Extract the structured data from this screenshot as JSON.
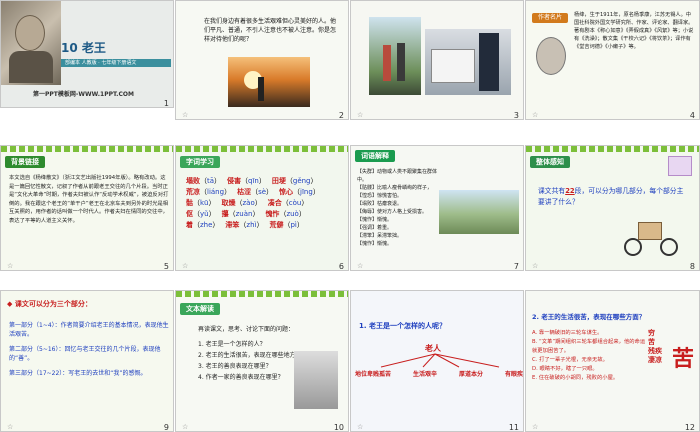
{
  "slides": [
    {
      "n": "1",
      "title": "10 老王",
      "sub": "部编本 人教版 · 七年级下册语文",
      "footer": "第一PPT模板网-WWW.1PPT.COM"
    },
    {
      "n": "2",
      "text": "在我们身边有着很多生活艰难但心灵美好的人。他们平凡、普通，不引人注意也不被人注意。你是怎样对待他们的呢？"
    },
    {
      "n": "3"
    },
    {
      "n": "4",
      "tag": "作者名片",
      "text": "杨绛，生于1911年，原名杨季康，江苏无锡人。中国社科院外国文学研究所、作家、评论家、翻译家。著有剧本《称心如意》《弄假成真》《风絮》等；小说有《洗澡》；散文集《干校六记》《将饮茶》；译作有《堂吉诃德》《小癞子》等。"
    },
    {
      "n": "5",
      "tag": "背景链接",
      "text": "本文选自《杨绛散文》（浙江文艺出版社1994年版）。略有改动。这是一篇回忆性散文，记叙了作者从前跟老王交往的几个片段。当时正是“文化大革命”时期，作者夫妇被认作“反动学术权威”，被迫反对打倒的。我在跟这个老王的“单干户”老王在北京车夫到另外的时光是相互关照的，用作者的话叫做一个时代人。作者夫妇在情同的交往中，表达了平等的人道主义关怀。"
    },
    {
      "n": "6",
      "tag": "字词学习",
      "words": [
        [
          "塌败",
          "tā",
          "侵害",
          "qīn",
          "田埂",
          "gěng"
        ],
        [
          "荒凉",
          "liáng",
          "枯涩",
          "sè",
          "惊心",
          "jīng"
        ],
        [
          "骷",
          "kū",
          "取燥",
          "zào",
          "凑合",
          "còu"
        ],
        [
          "伛",
          "yǔ",
          "攥",
          "zuàn",
          "愧怍",
          "zuò"
        ],
        [
          "着",
          "zhe",
          "滞笨",
          "zhì",
          "荒僻",
          "pì"
        ]
      ]
    },
    {
      "n": "7",
      "tag": "词语解释",
      "items": [
        "【失群】动物或人类不跟聚集在群体中。",
        "【骷髅】比喻人瘦骨嶙峋的样子，",
        "【惶恐】惊慌害怕。",
        "【塌败】枯瘪衰退。",
        "【侮辱】使对方人格上受损害。",
        "【愧怍】惭愧。",
        "【强调】着重。",
        "【滞笨】呆滞笨拙。",
        "【愧怍】惭愧。"
      ]
    },
    {
      "n": "8",
      "tag": "整体感知",
      "text": "课文共有",
      "mid": "22",
      "text2": "段，可以分为哪几部分，每个部分主要讲了什么？"
    },
    {
      "n": "9",
      "head": "课文可以分为三个部分：",
      "items": [
        "第一部分（1~4）：作者简要介绍老王的基本情况，表现他生活艰苦。",
        "第二部分（5~16）：回忆与老王交往的几个片段，表现他的“善”。",
        "第三部分（17~22）：写老王的去世和“我”的感慨。"
      ]
    },
    {
      "n": "10",
      "tag": "文本解读",
      "lead": "再读课文，思考、讨论下面的问题：",
      "items": [
        "1. 老王是一个怎样的人？",
        "2. 老王的生活很苦，表现在哪些地方？",
        "3. 老王的善良表现在哪里？",
        "4. 作者一家的善良表现在哪里？"
      ]
    },
    {
      "n": "11",
      "q": "1. 老王是一个怎样的人呢？",
      "root": "老人",
      "leaves": [
        "地位卑贱孤苦",
        "生活艰辛",
        "厚道本分",
        "有眼疾"
      ]
    },
    {
      "n": "12",
      "q": "2. 老王的生活很苦，表现在哪些方面？",
      "items": [
        "A. 靠一辆破旧的三轮车谋生。",
        "B. “文革”期间组织三轮车都组合起来，他的命运就更加困苦了。",
        "C. 打了一辈子光棍，无亲无故。",
        "D. 眼睛不好，瞎了一只眼。",
        "E. 住在破破的小胡同，残败的小屋。"
      ],
      "side": [
        "穷",
        "苦",
        "残疾",
        "凄凉"
      ],
      "big": "苦"
    }
  ]
}
